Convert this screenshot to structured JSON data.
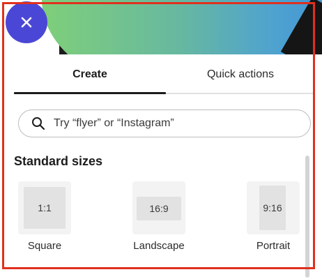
{
  "close": {
    "icon": "close-icon"
  },
  "tabs": [
    {
      "label": "Create",
      "active": true
    },
    {
      "label": "Quick actions",
      "active": false
    }
  ],
  "search": {
    "placeholder": "Try “flyer” or “Instagram”",
    "icon": "search-icon",
    "value": ""
  },
  "standard_sizes": {
    "title": "Standard sizes",
    "items": [
      {
        "ratio": "1:1",
        "label": "Square"
      },
      {
        "ratio": "16:9",
        "label": "Landscape"
      },
      {
        "ratio": "9:16",
        "label": "Portrait"
      }
    ]
  },
  "colors": {
    "close_button": "#4b47d6",
    "highlight_frame": "#e0301e",
    "active_tab_indicator": "#1c1c1c"
  }
}
